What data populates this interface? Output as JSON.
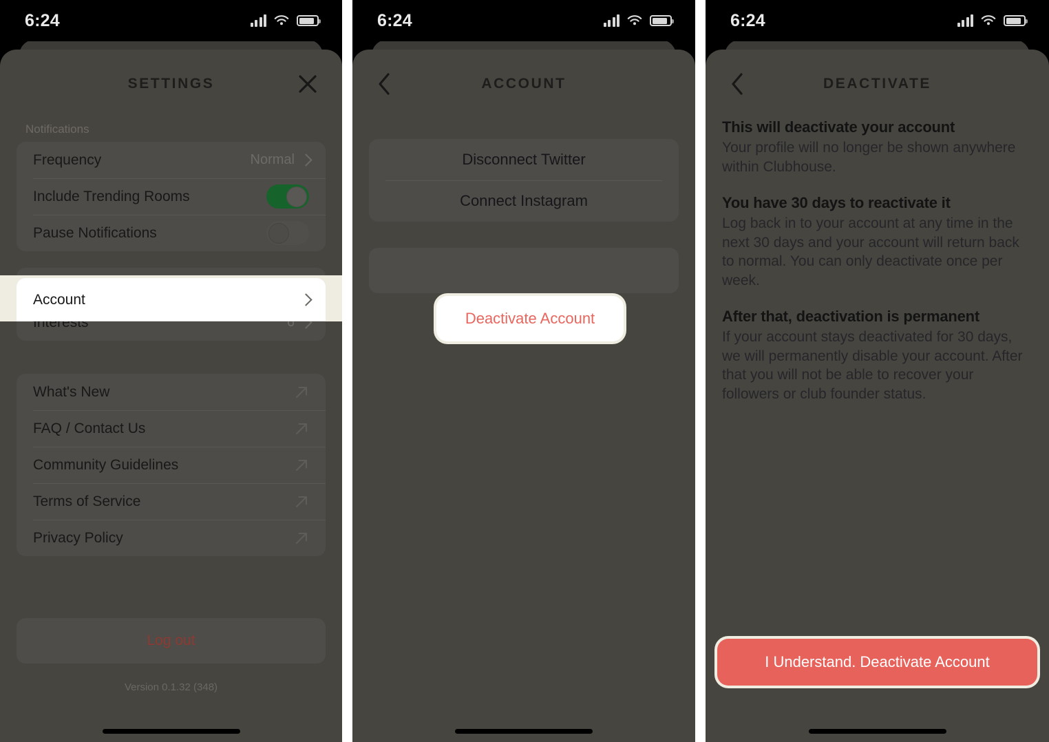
{
  "status_bar": {
    "time": "6:24",
    "icons": [
      "cellular-bars-icon",
      "wifi-icon",
      "battery-icon"
    ]
  },
  "colors": {
    "sheet_bg": "#474540",
    "card_bg": "#4e4c48",
    "highlight_band": "#efece1",
    "highlight_card": "#ffffff",
    "toggle_on": "#17632c",
    "destructive_red": "#e8625c",
    "logout_red": "#8c3a32"
  },
  "panel_settings": {
    "title": "SETTINGS",
    "close_icon": "close-icon",
    "section_notifications_label": "Notifications",
    "notification_rows": [
      {
        "label": "Frequency",
        "value": "Normal",
        "accessory": "chevron-right-icon"
      },
      {
        "label": "Include Trending Rooms",
        "accessory": "toggle",
        "toggle_on": true
      },
      {
        "label": "Pause Notifications",
        "accessory": "toggle",
        "toggle_on": false
      }
    ],
    "account_row": {
      "label": "Account",
      "accessory": "chevron-right-icon",
      "highlighted": true
    },
    "interests_row": {
      "label": "Interests",
      "value": "6",
      "accessory": "chevron-right-icon"
    },
    "link_rows": [
      {
        "label": "What's New",
        "accessory": "external-link-icon"
      },
      {
        "label": "FAQ / Contact Us",
        "accessory": "external-link-icon"
      },
      {
        "label": "Community Guidelines",
        "accessory": "external-link-icon"
      },
      {
        "label": "Terms of Service",
        "accessory": "external-link-icon"
      },
      {
        "label": "Privacy Policy",
        "accessory": "external-link-icon"
      }
    ],
    "logout_label": "Log out",
    "version": "Version 0.1.32 (348)"
  },
  "panel_account": {
    "title": "ACCOUNT",
    "back_icon": "chevron-left-icon",
    "rows": [
      {
        "label": "Disconnect Twitter"
      },
      {
        "label": "Connect Instagram"
      }
    ],
    "deactivate_label": "Deactivate Account",
    "deactivate_highlighted": true
  },
  "panel_deactivate": {
    "title": "DEACTIVATE",
    "back_icon": "chevron-left-icon",
    "paragraphs": [
      {
        "heading": "This will deactivate your account",
        "body": "Your profile will no longer be shown anywhere within Clubhouse."
      },
      {
        "heading": "You have 30 days to reactivate it",
        "body": "Log back in to your account at any time in the next 30 days and your account will return back to normal. You can only deactivate once per week."
      },
      {
        "heading": "After that, deactivation is permanent",
        "body": "If your account stays deactivated for 30 days, we will permanently disable your account. After that you will not be able to recover your followers or club founder status."
      }
    ],
    "cta_label": "I Understand. Deactivate Account"
  }
}
